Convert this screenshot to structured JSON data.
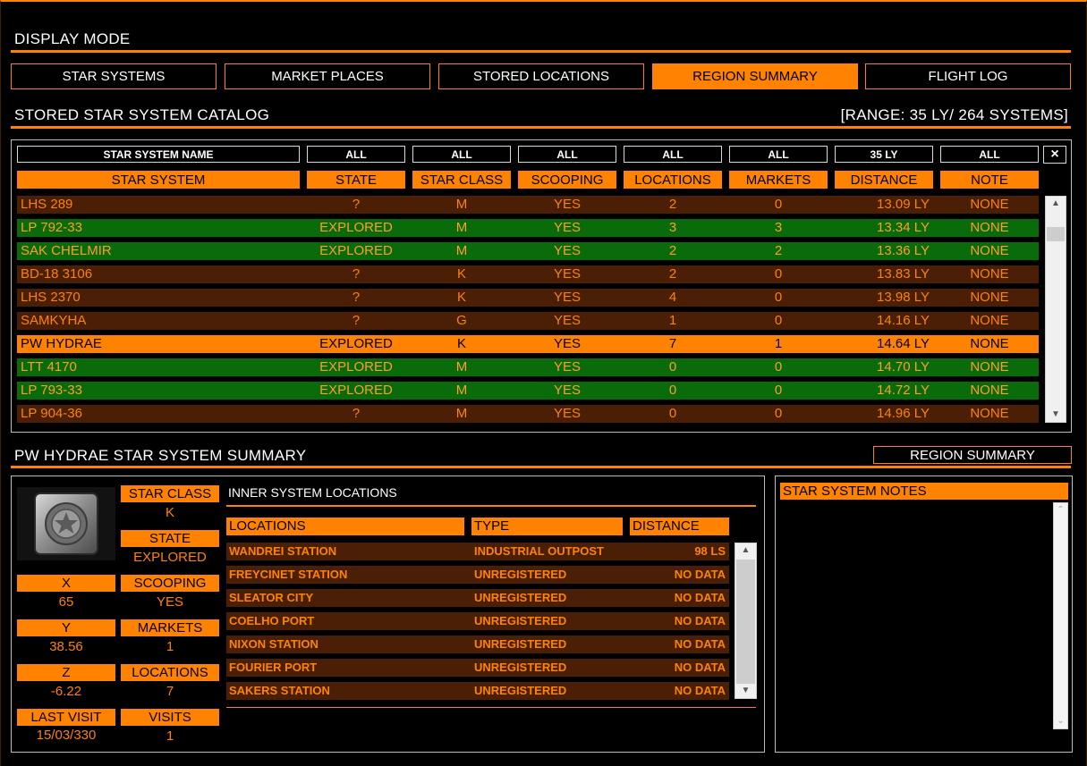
{
  "display_mode": {
    "title": "DISPLAY MODE",
    "tabs": [
      {
        "label": "STAR SYSTEMS",
        "active": false
      },
      {
        "label": "MARKET PLACES",
        "active": false
      },
      {
        "label": "STORED LOCATIONS",
        "active": false
      },
      {
        "label": "REGION SUMMARY",
        "active": true
      },
      {
        "label": "FLIGHT LOG",
        "active": false
      }
    ]
  },
  "catalog": {
    "title": "STORED STAR SYSTEM CATALOG",
    "range_info": "[RANGE: 35 LY/ 264 SYSTEMS]",
    "filters": {
      "name_placeholder": "STAR SYSTEM NAME",
      "state": "ALL",
      "star_class": "ALL",
      "scooping": "ALL",
      "locations": "ALL",
      "markets": "ALL",
      "distance": "35 LY",
      "note": "ALL",
      "clear": "×"
    },
    "columns": [
      "STAR SYSTEM",
      "STATE",
      "STAR CLASS",
      "SCOOPING",
      "LOCATIONS",
      "MARKETS",
      "DISTANCE",
      "NOTE"
    ],
    "rows": [
      {
        "name": "LHS 289",
        "state": "?",
        "star_class": "M",
        "scooping": "YES",
        "locations": "2",
        "markets": "0",
        "distance": "13.09 LY",
        "note": "NONE",
        "kind": "unexp"
      },
      {
        "name": "LP 792-33",
        "state": "EXPLORED",
        "star_class": "M",
        "scooping": "YES",
        "locations": "3",
        "markets": "3",
        "distance": "13.34 LY",
        "note": "NONE",
        "kind": "expl"
      },
      {
        "name": "SAK CHELMIR",
        "state": "EXPLORED",
        "star_class": "M",
        "scooping": "YES",
        "locations": "2",
        "markets": "2",
        "distance": "13.36 LY",
        "note": "NONE",
        "kind": "expl"
      },
      {
        "name": "BD-18 3106",
        "state": "?",
        "star_class": "K",
        "scooping": "YES",
        "locations": "2",
        "markets": "0",
        "distance": "13.83 LY",
        "note": "NONE",
        "kind": "unexp"
      },
      {
        "name": "LHS 2370",
        "state": "?",
        "star_class": "K",
        "scooping": "YES",
        "locations": "4",
        "markets": "0",
        "distance": "13.98 LY",
        "note": "NONE",
        "kind": "unexp"
      },
      {
        "name": "SAMKYHA",
        "state": "?",
        "star_class": "G",
        "scooping": "YES",
        "locations": "1",
        "markets": "0",
        "distance": "14.16 LY",
        "note": "NONE",
        "kind": "unexp"
      },
      {
        "name": "PW HYDRAE",
        "state": "EXPLORED",
        "star_class": "K",
        "scooping": "YES",
        "locations": "7",
        "markets": "1",
        "distance": "14.64 LY",
        "note": "NONE",
        "kind": "sel"
      },
      {
        "name": "LTT 4170",
        "state": "EXPLORED",
        "star_class": "M",
        "scooping": "YES",
        "locations": "0",
        "markets": "0",
        "distance": "14.70 LY",
        "note": "NONE",
        "kind": "expl"
      },
      {
        "name": "LP 793-33",
        "state": "EXPLORED",
        "star_class": "M",
        "scooping": "YES",
        "locations": "0",
        "markets": "0",
        "distance": "14.72 LY",
        "note": "NONE",
        "kind": "expl"
      },
      {
        "name": "LP 904-36",
        "state": "?",
        "star_class": "M",
        "scooping": "YES",
        "locations": "0",
        "markets": "0",
        "distance": "14.96 LY",
        "note": "NONE",
        "kind": "unexp"
      }
    ]
  },
  "summary": {
    "title": "PW HYDRAE STAR SYSTEM SUMMARY",
    "region_button": "REGION SUMMARY",
    "fields": {
      "star_class": {
        "label": "STAR CLASS",
        "value": "K"
      },
      "state": {
        "label": "STATE",
        "value": "EXPLORED"
      },
      "x": {
        "label": "X",
        "value": "65"
      },
      "scooping": {
        "label": "SCOOPING",
        "value": "YES"
      },
      "y": {
        "label": "Y",
        "value": "38.56"
      },
      "markets": {
        "label": "MARKETS",
        "value": "1"
      },
      "z": {
        "label": "Z",
        "value": "-6.22"
      },
      "locations": {
        "label": "LOCATIONS",
        "value": "7"
      },
      "last_visit": {
        "label": "LAST VISIT",
        "value": "15/03/330"
      },
      "visits": {
        "label": "VISITS",
        "value": "1"
      }
    },
    "inner": {
      "title": "INNER SYSTEM LOCATIONS",
      "columns": [
        "LOCATIONS",
        "TYPE",
        "DISTANCE"
      ],
      "rows": [
        {
          "name": "WANDREI STATION",
          "type": "INDUSTRIAL OUTPOST",
          "distance": "98 LS"
        },
        {
          "name": "FREYCINET STATION",
          "type": "UNREGISTERED",
          "distance": "NO DATA"
        },
        {
          "name": "SLEATOR CITY",
          "type": "UNREGISTERED",
          "distance": "NO DATA"
        },
        {
          "name": "COELHO PORT",
          "type": "UNREGISTERED",
          "distance": "NO DATA"
        },
        {
          "name": "NIXON STATION",
          "type": "UNREGISTERED",
          "distance": "NO DATA"
        },
        {
          "name": "FOURIER PORT",
          "type": "UNREGISTERED",
          "distance": "NO DATA"
        },
        {
          "name": "SAKERS STATION",
          "type": "UNREGISTERED",
          "distance": "NO DATA"
        }
      ]
    },
    "notes_title": "STAR SYSTEM NOTES"
  },
  "colors": {
    "accent": "#ff8200",
    "explored_row": "#0a6b0a",
    "unexplored_row": "#4a1f06",
    "background": "#000000"
  },
  "icons": {
    "star_emblem": "star-emblem-icon",
    "scroll_up": "chevron-up-icon",
    "scroll_down": "chevron-down-icon",
    "clear": "close-icon"
  }
}
